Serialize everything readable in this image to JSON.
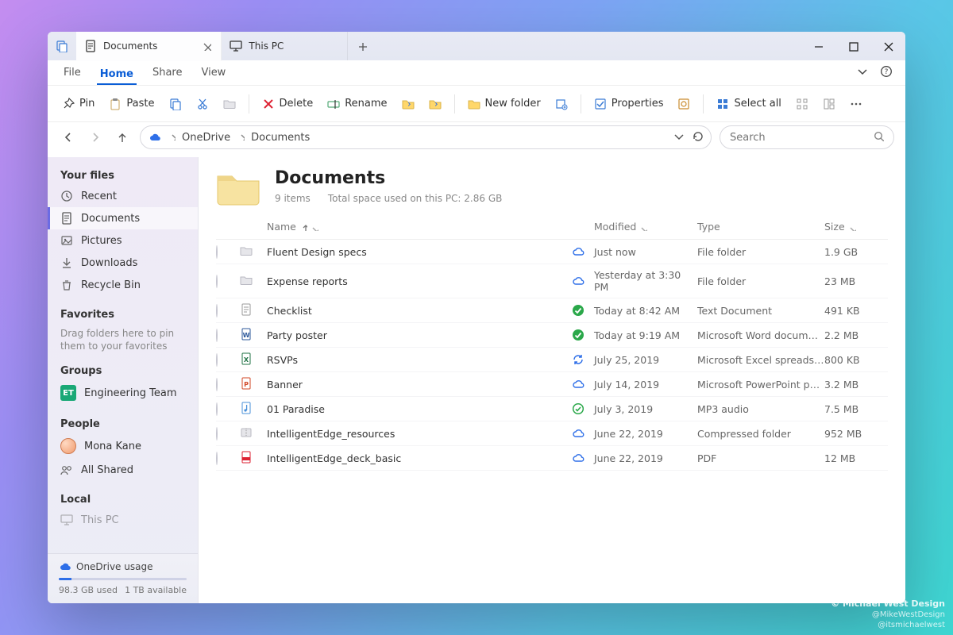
{
  "tabs": [
    {
      "label": "Documents",
      "active": true
    },
    {
      "label": "This PC",
      "active": false
    }
  ],
  "menu": {
    "items": [
      "File",
      "Home",
      "Share",
      "View"
    ],
    "active_index": 1
  },
  "ribbon": {
    "pin": "Pin",
    "paste": "Paste",
    "delete": "Delete",
    "rename": "Rename",
    "new_folder": "New folder",
    "properties": "Properties",
    "select_all": "Select all"
  },
  "breadcrumb": {
    "root": "OneDrive",
    "current": "Documents"
  },
  "search": {
    "placeholder": "Search"
  },
  "sidebar": {
    "your_files": "Your files",
    "items": [
      {
        "icon": "recent",
        "label": "Recent"
      },
      {
        "icon": "document",
        "label": "Documents",
        "selected": true
      },
      {
        "icon": "pictures",
        "label": "Pictures"
      },
      {
        "icon": "downloads",
        "label": "Downloads"
      },
      {
        "icon": "recycle",
        "label": "Recycle Bin"
      }
    ],
    "favorites": "Favorites",
    "favorites_hint": "Drag folders here to pin them to your favorites",
    "groups": "Groups",
    "group": {
      "initials": "ET",
      "label": "Engineering Team"
    },
    "people": "People",
    "people_items": [
      {
        "kind": "avatar",
        "label": "Mona Kane"
      },
      {
        "kind": "shared",
        "label": "All Shared"
      }
    ],
    "local": "Local",
    "local_item": "This PC",
    "usage": {
      "title": "OneDrive usage",
      "used": "98.3 GB used",
      "available": "1 TB available",
      "pct": 10
    }
  },
  "content": {
    "title": "Documents",
    "count_label": "9 items",
    "space_label": "Total space used on this PC: 2.86 GB",
    "columns": {
      "name": "Name",
      "modified": "Modified",
      "type": "Type",
      "size": "Size"
    },
    "rows": [
      {
        "icon": "folder",
        "name": "Fluent Design specs",
        "status": "cloud",
        "modified": "Just now",
        "type": "File folder",
        "size": "1.9 GB"
      },
      {
        "icon": "folder",
        "name": "Expense reports",
        "status": "cloud",
        "modified": "Yesterday at 3:30 PM",
        "type": "File folder",
        "size": "23 MB"
      },
      {
        "icon": "txt",
        "name": "Checklist",
        "status": "ok",
        "modified": "Today at 8:42 AM",
        "type": "Text Document",
        "size": "491 KB"
      },
      {
        "icon": "word",
        "name": "Party poster",
        "status": "ok",
        "modified": "Today at 9:19 AM",
        "type": "Microsoft Word docum…",
        "size": "2.2 MB"
      },
      {
        "icon": "excel",
        "name": "RSVPs",
        "status": "sync",
        "modified": "July 25, 2019",
        "type": "Microsoft Excel spreads…",
        "size": "800 KB"
      },
      {
        "icon": "ppt",
        "name": "Banner",
        "status": "cloud",
        "modified": "July 14, 2019",
        "type": "Microsoft PowerPoint p…",
        "size": "3.2 MB"
      },
      {
        "icon": "audio",
        "name": "01 Paradise",
        "status": "ok-open",
        "modified": "July 3, 2019",
        "type": "MP3 audio",
        "size": "7.5 MB"
      },
      {
        "icon": "zip",
        "name": "IntelligentEdge_resources",
        "status": "cloud",
        "modified": "June 22, 2019",
        "type": "Compressed folder",
        "size": "952 MB"
      },
      {
        "icon": "pdf",
        "name": "IntelligentEdge_deck_basic",
        "status": "cloud",
        "modified": "June 22, 2019",
        "type": "PDF",
        "size": "12 MB"
      }
    ]
  },
  "credits": {
    "line1": "© Michael West Design",
    "line2": "@MikeWestDesign",
    "line3": "@itsmichaelwest"
  }
}
